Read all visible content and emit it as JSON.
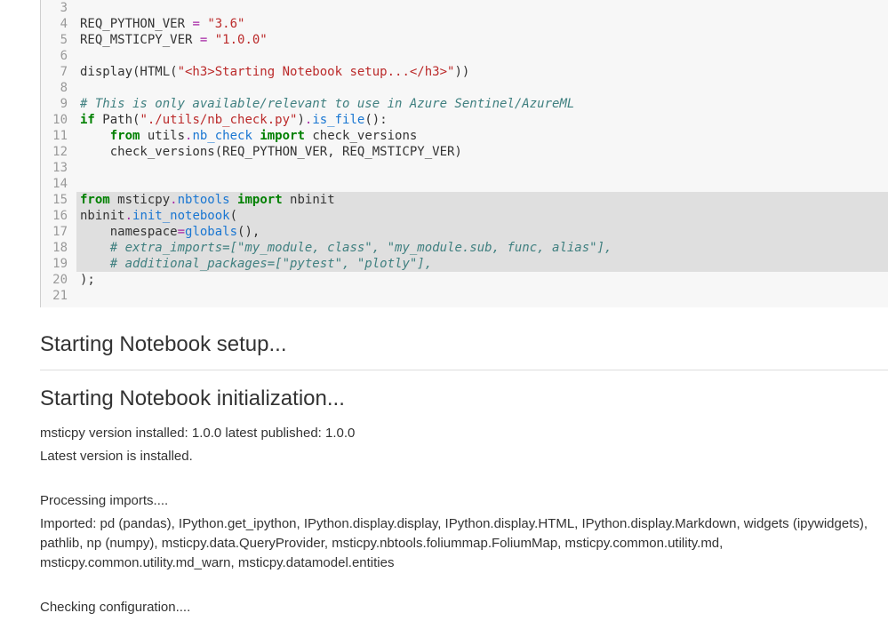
{
  "code": {
    "lines": [
      {
        "n": 3,
        "hl": false,
        "tokens": []
      },
      {
        "n": 4,
        "hl": false,
        "tokens": [
          {
            "t": "REQ_PYTHON_VER ",
            "c": ""
          },
          {
            "t": "=",
            "c": "tok-op"
          },
          {
            "t": " ",
            "c": ""
          },
          {
            "t": "\"3.6\"",
            "c": "tok-str"
          }
        ]
      },
      {
        "n": 5,
        "hl": false,
        "tokens": [
          {
            "t": "REQ_MSTICPY_VER ",
            "c": ""
          },
          {
            "t": "=",
            "c": "tok-op"
          },
          {
            "t": " ",
            "c": ""
          },
          {
            "t": "\"1.0.0\"",
            "c": "tok-str"
          }
        ]
      },
      {
        "n": 6,
        "hl": false,
        "tokens": []
      },
      {
        "n": 7,
        "hl": false,
        "tokens": [
          {
            "t": "display(HTML(",
            "c": ""
          },
          {
            "t": "\"<h3>Starting Notebook setup...</h3>\"",
            "c": "tok-str"
          },
          {
            "t": "))",
            "c": ""
          }
        ]
      },
      {
        "n": 8,
        "hl": false,
        "tokens": []
      },
      {
        "n": 9,
        "hl": false,
        "tokens": [
          {
            "t": "# This is only available/relevant to use in Azure Sentinel/AzureML",
            "c": "tok-comm"
          }
        ]
      },
      {
        "n": 10,
        "hl": false,
        "tokens": [
          {
            "t": "if",
            "c": "tok-kw"
          },
          {
            "t": " Path(",
            "c": ""
          },
          {
            "t": "\"./utils/nb_check.py\"",
            "c": "tok-str"
          },
          {
            "t": ")",
            "c": ""
          },
          {
            "t": ".",
            "c": "tok-op"
          },
          {
            "t": "is_file",
            "c": "tok-attr"
          },
          {
            "t": "():",
            "c": ""
          }
        ]
      },
      {
        "n": 11,
        "hl": false,
        "tokens": [
          {
            "t": "    ",
            "c": ""
          },
          {
            "t": "from",
            "c": "tok-kw"
          },
          {
            "t": " utils",
            "c": ""
          },
          {
            "t": ".",
            "c": "tok-op"
          },
          {
            "t": "nb_check",
            "c": "tok-attr"
          },
          {
            "t": " ",
            "c": ""
          },
          {
            "t": "import",
            "c": "tok-kw"
          },
          {
            "t": " check_versions",
            "c": ""
          }
        ]
      },
      {
        "n": 12,
        "hl": false,
        "tokens": [
          {
            "t": "    check_versions(REQ_PYTHON_VER, REQ_MSTICPY_VER)",
            "c": ""
          }
        ]
      },
      {
        "n": 13,
        "hl": false,
        "tokens": []
      },
      {
        "n": 14,
        "hl": false,
        "tokens": []
      },
      {
        "n": 15,
        "hl": true,
        "tokens": [
          {
            "t": "from",
            "c": "tok-kw"
          },
          {
            "t": " msticpy",
            "c": ""
          },
          {
            "t": ".",
            "c": "tok-op"
          },
          {
            "t": "nbtools",
            "c": "tok-attr"
          },
          {
            "t": " ",
            "c": ""
          },
          {
            "t": "import",
            "c": "tok-kw"
          },
          {
            "t": " nbinit",
            "c": ""
          }
        ]
      },
      {
        "n": 16,
        "hl": true,
        "tokens": [
          {
            "t": "nbinit",
            "c": ""
          },
          {
            "t": ".",
            "c": "tok-op"
          },
          {
            "t": "init_notebook",
            "c": "tok-attr"
          },
          {
            "t": "(",
            "c": ""
          }
        ]
      },
      {
        "n": 17,
        "hl": true,
        "tokens": [
          {
            "t": "    namespace",
            "c": ""
          },
          {
            "t": "=",
            "c": "tok-op"
          },
          {
            "t": "globals",
            "c": "tok-attr"
          },
          {
            "t": "(),",
            "c": ""
          }
        ]
      },
      {
        "n": 18,
        "hl": true,
        "tokens": [
          {
            "t": "    ",
            "c": ""
          },
          {
            "t": "# extra_imports=[\"my_module, class\", \"my_module.sub, func, alias\"],",
            "c": "tok-comm"
          }
        ]
      },
      {
        "n": 19,
        "hl": true,
        "tokens": [
          {
            "t": "    ",
            "c": ""
          },
          {
            "t": "# additional_packages=[\"pytest\", \"plotly\"],",
            "c": "tok-comm"
          }
        ]
      },
      {
        "n": 20,
        "hl": false,
        "tokens": [
          {
            "t": ");",
            "c": ""
          }
        ]
      },
      {
        "n": 21,
        "hl": false,
        "tokens": []
      }
    ]
  },
  "output": {
    "heading_setup": "Starting Notebook setup...",
    "heading_init": "Starting Notebook initialization...",
    "version_line": "msticpy version installed: 1.0.0 latest published: 1.0.0",
    "latest_line": "Latest version is installed.",
    "processing": "Processing imports....",
    "imported": "Imported: pd (pandas), IPython.get_ipython, IPython.display.display, IPython.display.HTML, IPython.display.Markdown, widgets (ipywidgets), pathlib, np (numpy), msticpy.data.QueryProvider, msticpy.nbtools.foliummap.FoliumMap, msticpy.common.utility.md, msticpy.common.utility.md_warn, msticpy.datamodel.entities",
    "checking": "Checking configuration...."
  }
}
